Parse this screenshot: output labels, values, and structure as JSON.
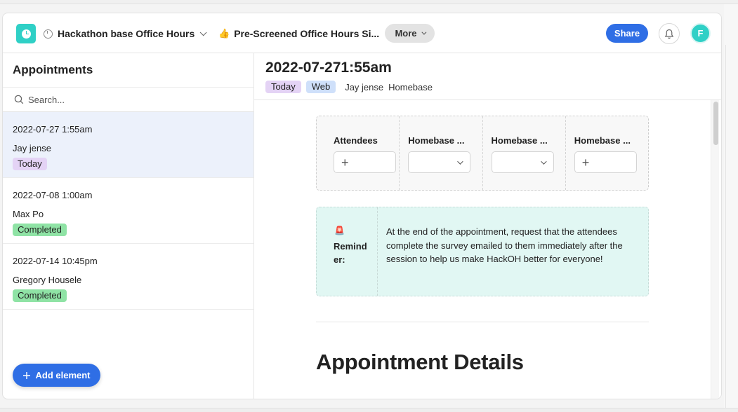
{
  "header": {
    "tabs": [
      {
        "label": "Hackathon base Office Hours",
        "icon": "clock-icon"
      },
      {
        "label": "Pre-Screened Office Hours Si...",
        "emoji": "👍"
      }
    ],
    "more_label": "More",
    "share_label": "Share",
    "avatar_initial": "F"
  },
  "sidebar": {
    "title": "Appointments",
    "search_placeholder": "Search...",
    "items": [
      {
        "date": "2022-07-27 1:55am",
        "name": "Jay jense",
        "status": "Today"
      },
      {
        "date": "2022-07-08 1:00am",
        "name": "Max Po",
        "status": "Completed"
      },
      {
        "date": "2022-07-14 10:45pm",
        "name": "Gregory Housele",
        "status": "Completed"
      }
    ],
    "add_label": "Add element"
  },
  "main": {
    "title": "2022-07-271:55am",
    "tags": [
      "Today",
      "Web"
    ],
    "attendee": "Jay jense",
    "location": "Homebase",
    "fields": [
      {
        "label": "Attendees"
      },
      {
        "label": "Homebase ..."
      },
      {
        "label": "Homebase ..."
      },
      {
        "label": "Homebase ..."
      }
    ],
    "reminder": {
      "emoji": "🚨",
      "label": "Remind er:",
      "text": "At the end of the appointment, request that the attendees complete the  survey emailed to them immediately after the session to help us make HackOH better for everyone!"
    },
    "section_title": "Appointment Details"
  },
  "colors": {
    "accent": "#2f6ee5",
    "logo": "#2fd0c6",
    "today_badge": "#e4d3f5",
    "web_badge": "#cfe0fa",
    "completed_badge": "#8fe3a5",
    "reminder_bg": "#e1f7f3"
  }
}
